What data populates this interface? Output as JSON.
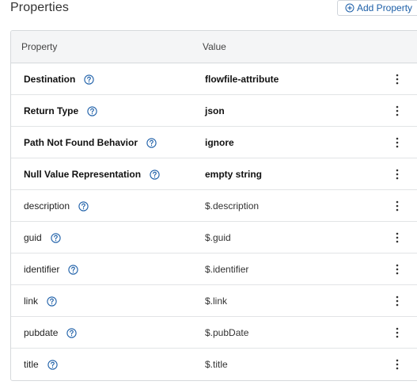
{
  "header": {
    "title": "Properties",
    "add_button_label": "Add Property"
  },
  "table": {
    "columns": {
      "property": "Property",
      "value": "Value"
    },
    "rows": [
      {
        "property": "Destination",
        "value": "flowfile-attribute",
        "required": true
      },
      {
        "property": "Return Type",
        "value": "json",
        "required": true
      },
      {
        "property": "Path Not Found Behavior",
        "value": "ignore",
        "required": true
      },
      {
        "property": "Null Value Representation",
        "value": "empty string",
        "required": true
      },
      {
        "property": "description",
        "value": "$.description",
        "required": false
      },
      {
        "property": "guid",
        "value": "$.guid",
        "required": false
      },
      {
        "property": "identifier",
        "value": "$.identifier",
        "required": false
      },
      {
        "property": "link",
        "value": "$.link",
        "required": false
      },
      {
        "property": "pubdate",
        "value": "$.pubDate",
        "required": false
      },
      {
        "property": "title",
        "value": "$.title",
        "required": false
      }
    ]
  },
  "colors": {
    "accent": "#1d5fa8",
    "header_bg": "#f4f5f6",
    "border": "#d6d9dc"
  },
  "icons": {
    "add": "plus-circle-icon",
    "help": "help-icon",
    "row_menu": "kebab-icon"
  }
}
